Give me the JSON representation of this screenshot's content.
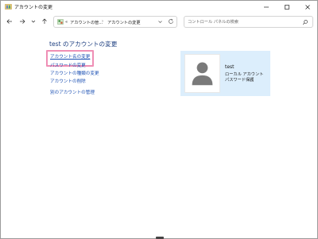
{
  "window": {
    "title": "アカウントの変更"
  },
  "toolbar": {
    "breadcrumb": {
      "overflow": "«",
      "items": [
        "アカウントの管...",
        "アカウントの変更"
      ],
      "separator": "›"
    },
    "search_placeholder": "コントロール パネルの検索"
  },
  "main": {
    "title": "test のアカウントの変更",
    "tasks": [
      "アカウント名の変更",
      "パスワードの変更",
      "アカウントの種類の変更",
      "アカウントの削除",
      "別のアカウントの管理"
    ]
  },
  "account": {
    "name": "test",
    "type": "ローカル アカウント",
    "password_status": "パスワード保護"
  },
  "colors": {
    "link": "#1a4fb3",
    "title": "#1e3f80",
    "card_background": "#dceefc",
    "highlight": "#ef8fb5"
  }
}
